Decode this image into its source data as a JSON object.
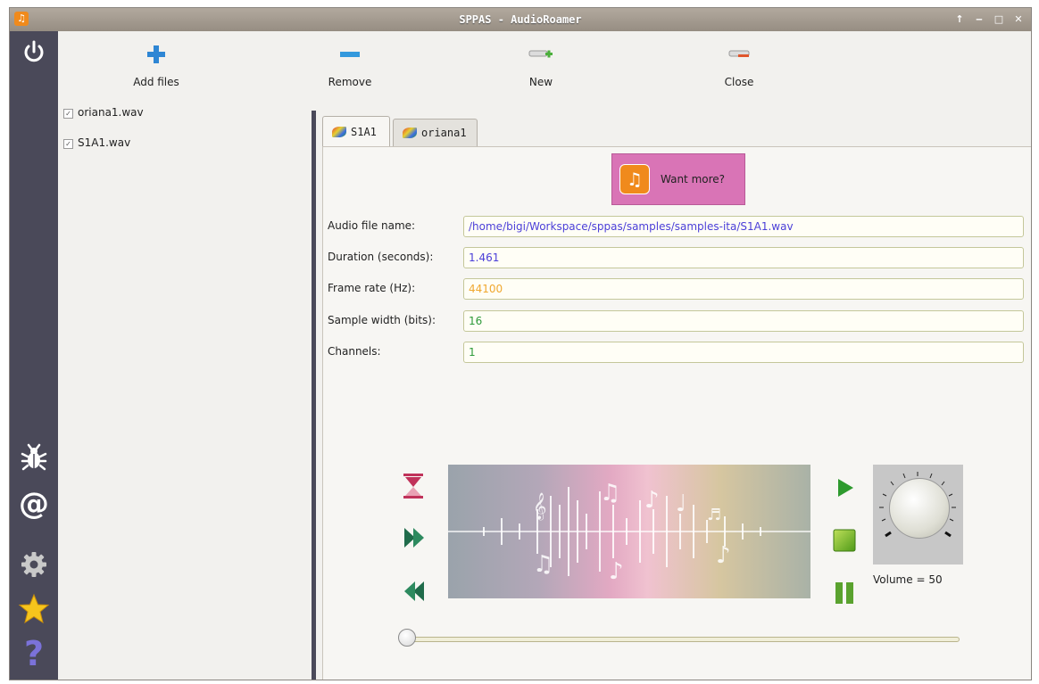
{
  "window": {
    "title": "SPPAS - AudioRoamer",
    "controls": [
      "↑",
      "‒",
      "□",
      "✕"
    ]
  },
  "toolbar": {
    "add_files": "Add files",
    "remove": "Remove",
    "new": "New",
    "close": "Close"
  },
  "files": [
    {
      "name": "oriana1.wav",
      "checked": true
    },
    {
      "name": "S1A1.wav",
      "checked": true
    }
  ],
  "tabs": [
    {
      "label": "S1A1",
      "active": true
    },
    {
      "label": "oriana1",
      "active": false
    }
  ],
  "want_more": "Want more?",
  "fields": [
    {
      "label": "Audio file name:",
      "value": "/home/bigi/Workspace/sppas/samples/samples-ita/S1A1.wav",
      "color": "#4b3fd8"
    },
    {
      "label": "Duration (seconds):",
      "value": "1.461",
      "color": "#4b3fd8"
    },
    {
      "label": "Frame rate (Hz):",
      "value": "44100",
      "color": "#f0a830"
    },
    {
      "label": "Sample width (bits):",
      "value": "16",
      "color": "#2e9a3a"
    },
    {
      "label": "Channels:",
      "value": "1",
      "color": "#2e9a3a"
    }
  ],
  "player": {
    "volume_label": "Volume = 50",
    "volume": 50,
    "position": 0
  },
  "icons": {
    "sidebar": [
      "power-icon",
      "bug-icon",
      "at-icon",
      "gear-icon",
      "star-icon",
      "help-icon"
    ],
    "toolbar": [
      "plus-icon",
      "minus-icon",
      "new-icon",
      "close-icon"
    ],
    "player": [
      "hourglass-icon",
      "fast-forward-icon",
      "rewind-icon",
      "play-icon",
      "stop-icon",
      "pause-icon"
    ]
  }
}
